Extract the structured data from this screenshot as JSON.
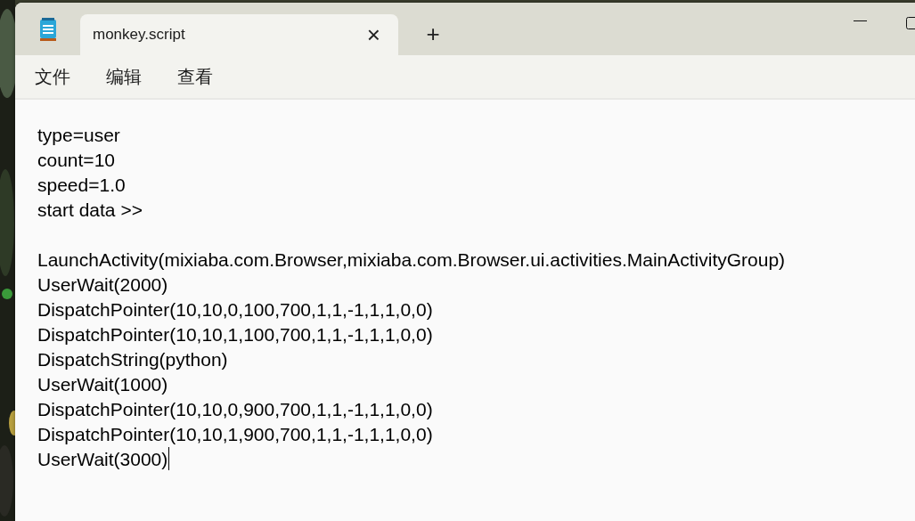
{
  "tab": {
    "title": "monkey.script",
    "close": "×",
    "new_tab": "+"
  },
  "menu": [
    "文件",
    "编辑",
    "查看"
  ],
  "blocks": [
    {
      "lines": [
        "type=user",
        "count=10",
        "speed=1.0",
        "start data >>"
      ]
    },
    {
      "lines": [
        "LaunchActivity(mixiaba.com.Browser,mixiaba.com.Browser.ui.activities.MainActivityGroup)",
        "UserWait(2000)",
        "DispatchPointer(10,10,0,100,700,1,1,-1,1,1,0,0)",
        "DispatchPointer(10,10,1,100,700,1,1,-1,1,1,0,0)",
        "DispatchString(python)",
        "UserWait(1000)",
        "DispatchPointer(10,10,0,900,700,1,1,-1,1,1,0,0)",
        "DispatchPointer(10,10,1,900,700,1,1,-1,1,1,0,0)",
        "UserWait(3000)"
      ]
    }
  ]
}
